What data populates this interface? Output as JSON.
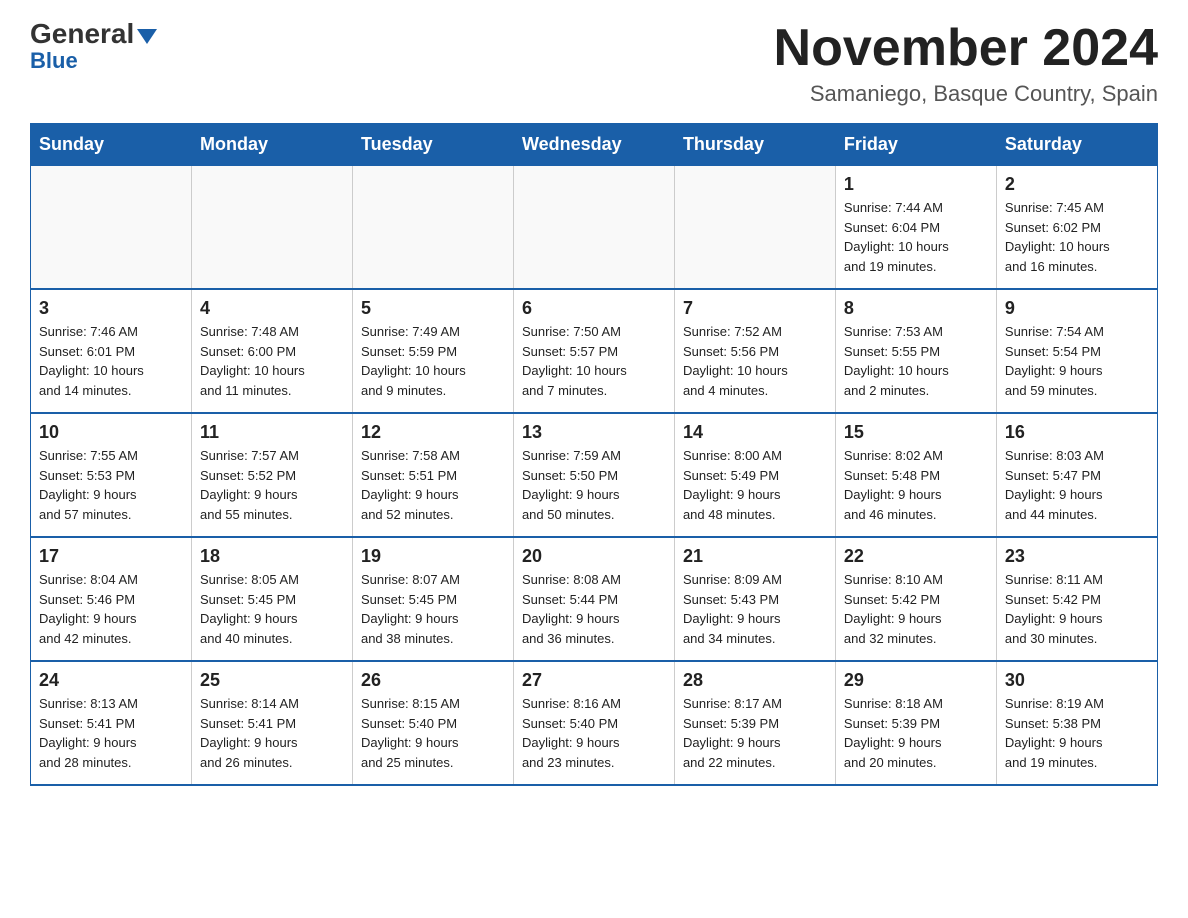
{
  "header": {
    "logo": {
      "general": "General",
      "blue": "Blue"
    },
    "title": "November 2024",
    "location": "Samaniego, Basque Country, Spain"
  },
  "days_of_week": [
    "Sunday",
    "Monday",
    "Tuesday",
    "Wednesday",
    "Thursday",
    "Friday",
    "Saturday"
  ],
  "weeks": [
    [
      {
        "day": "",
        "info": ""
      },
      {
        "day": "",
        "info": ""
      },
      {
        "day": "",
        "info": ""
      },
      {
        "day": "",
        "info": ""
      },
      {
        "day": "",
        "info": ""
      },
      {
        "day": "1",
        "info": "Sunrise: 7:44 AM\nSunset: 6:04 PM\nDaylight: 10 hours\nand 19 minutes."
      },
      {
        "day": "2",
        "info": "Sunrise: 7:45 AM\nSunset: 6:02 PM\nDaylight: 10 hours\nand 16 minutes."
      }
    ],
    [
      {
        "day": "3",
        "info": "Sunrise: 7:46 AM\nSunset: 6:01 PM\nDaylight: 10 hours\nand 14 minutes."
      },
      {
        "day": "4",
        "info": "Sunrise: 7:48 AM\nSunset: 6:00 PM\nDaylight: 10 hours\nand 11 minutes."
      },
      {
        "day": "5",
        "info": "Sunrise: 7:49 AM\nSunset: 5:59 PM\nDaylight: 10 hours\nand 9 minutes."
      },
      {
        "day": "6",
        "info": "Sunrise: 7:50 AM\nSunset: 5:57 PM\nDaylight: 10 hours\nand 7 minutes."
      },
      {
        "day": "7",
        "info": "Sunrise: 7:52 AM\nSunset: 5:56 PM\nDaylight: 10 hours\nand 4 minutes."
      },
      {
        "day": "8",
        "info": "Sunrise: 7:53 AM\nSunset: 5:55 PM\nDaylight: 10 hours\nand 2 minutes."
      },
      {
        "day": "9",
        "info": "Sunrise: 7:54 AM\nSunset: 5:54 PM\nDaylight: 9 hours\nand 59 minutes."
      }
    ],
    [
      {
        "day": "10",
        "info": "Sunrise: 7:55 AM\nSunset: 5:53 PM\nDaylight: 9 hours\nand 57 minutes."
      },
      {
        "day": "11",
        "info": "Sunrise: 7:57 AM\nSunset: 5:52 PM\nDaylight: 9 hours\nand 55 minutes."
      },
      {
        "day": "12",
        "info": "Sunrise: 7:58 AM\nSunset: 5:51 PM\nDaylight: 9 hours\nand 52 minutes."
      },
      {
        "day": "13",
        "info": "Sunrise: 7:59 AM\nSunset: 5:50 PM\nDaylight: 9 hours\nand 50 minutes."
      },
      {
        "day": "14",
        "info": "Sunrise: 8:00 AM\nSunset: 5:49 PM\nDaylight: 9 hours\nand 48 minutes."
      },
      {
        "day": "15",
        "info": "Sunrise: 8:02 AM\nSunset: 5:48 PM\nDaylight: 9 hours\nand 46 minutes."
      },
      {
        "day": "16",
        "info": "Sunrise: 8:03 AM\nSunset: 5:47 PM\nDaylight: 9 hours\nand 44 minutes."
      }
    ],
    [
      {
        "day": "17",
        "info": "Sunrise: 8:04 AM\nSunset: 5:46 PM\nDaylight: 9 hours\nand 42 minutes."
      },
      {
        "day": "18",
        "info": "Sunrise: 8:05 AM\nSunset: 5:45 PM\nDaylight: 9 hours\nand 40 minutes."
      },
      {
        "day": "19",
        "info": "Sunrise: 8:07 AM\nSunset: 5:45 PM\nDaylight: 9 hours\nand 38 minutes."
      },
      {
        "day": "20",
        "info": "Sunrise: 8:08 AM\nSunset: 5:44 PM\nDaylight: 9 hours\nand 36 minutes."
      },
      {
        "day": "21",
        "info": "Sunrise: 8:09 AM\nSunset: 5:43 PM\nDaylight: 9 hours\nand 34 minutes."
      },
      {
        "day": "22",
        "info": "Sunrise: 8:10 AM\nSunset: 5:42 PM\nDaylight: 9 hours\nand 32 minutes."
      },
      {
        "day": "23",
        "info": "Sunrise: 8:11 AM\nSunset: 5:42 PM\nDaylight: 9 hours\nand 30 minutes."
      }
    ],
    [
      {
        "day": "24",
        "info": "Sunrise: 8:13 AM\nSunset: 5:41 PM\nDaylight: 9 hours\nand 28 minutes."
      },
      {
        "day": "25",
        "info": "Sunrise: 8:14 AM\nSunset: 5:41 PM\nDaylight: 9 hours\nand 26 minutes."
      },
      {
        "day": "26",
        "info": "Sunrise: 8:15 AM\nSunset: 5:40 PM\nDaylight: 9 hours\nand 25 minutes."
      },
      {
        "day": "27",
        "info": "Sunrise: 8:16 AM\nSunset: 5:40 PM\nDaylight: 9 hours\nand 23 minutes."
      },
      {
        "day": "28",
        "info": "Sunrise: 8:17 AM\nSunset: 5:39 PM\nDaylight: 9 hours\nand 22 minutes."
      },
      {
        "day": "29",
        "info": "Sunrise: 8:18 AM\nSunset: 5:39 PM\nDaylight: 9 hours\nand 20 minutes."
      },
      {
        "day": "30",
        "info": "Sunrise: 8:19 AM\nSunset: 5:38 PM\nDaylight: 9 hours\nand 19 minutes."
      }
    ]
  ]
}
